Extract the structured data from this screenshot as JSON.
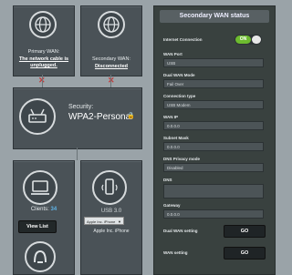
{
  "primary_wan": {
    "label": "Primary WAN:",
    "status": "The network cable is unplugged."
  },
  "secondary_wan": {
    "label": "Secondary WAN:",
    "status": "Disconnected"
  },
  "security": {
    "label": "Security:",
    "value": "WPA2-Personal"
  },
  "clients": {
    "label": "Clients:",
    "count": "34",
    "button": "View List"
  },
  "usb": {
    "label": "USB 3.0",
    "device_select": "Apple Inc. iPhone",
    "device_name": "Apple Inc. iPhone"
  },
  "panel": {
    "title": "Secondary WAN status",
    "internet_connection_label": "Internet Connection",
    "internet_connection_state": "ON",
    "wan_port_label": "WAN Port",
    "wan_port_value": "USB",
    "dual_wan_mode_label": "Dual WAN Mode",
    "dual_wan_mode_value": "Fail Over",
    "connection_type_label": "Connection type",
    "connection_type_value": "USB Modem",
    "wan_ip_label": "WAN IP",
    "wan_ip_value": "0.0.0.0",
    "subnet_mask_label": "Subnet Mask",
    "subnet_mask_value": "0.0.0.0",
    "dns_privacy_label": "DNS Privacy mode",
    "dns_privacy_value": "Disabled",
    "dns_label": "DNS",
    "dns_value": "",
    "gateway_label": "Gateway",
    "gateway_value": "0.0.0.0",
    "dual_wan_setting_label": "Dual WAN setting",
    "dual_wan_setting_button": "GO",
    "wan_setting_label": "WAN setting",
    "wan_setting_button": "GO"
  }
}
